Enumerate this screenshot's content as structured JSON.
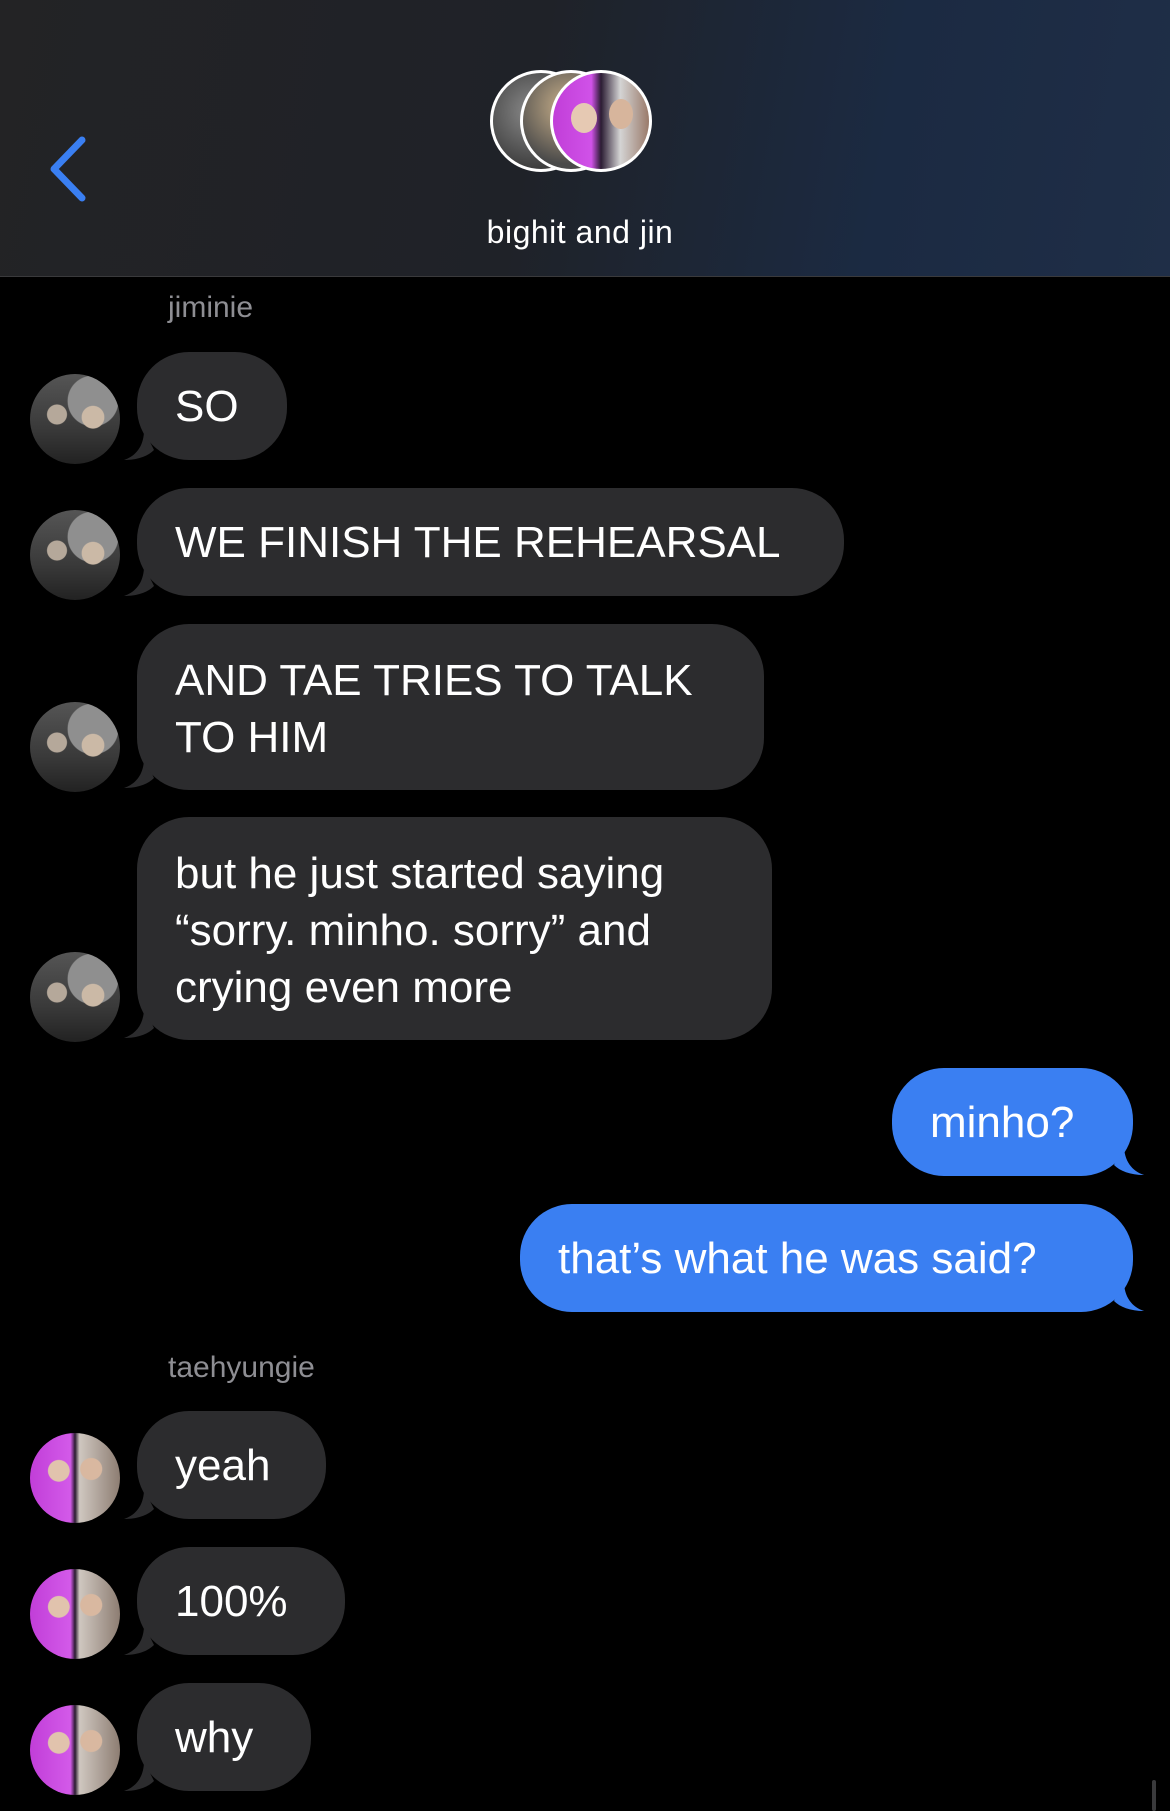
{
  "header": {
    "title": "bighit and jin",
    "back_icon": "chevron-left-icon",
    "accent": "#3a7ff2"
  },
  "senders": {
    "first": "jiminie",
    "second": "taehyungie"
  },
  "messages": [
    {
      "from": "jiminie",
      "text": "SO"
    },
    {
      "from": "jiminie",
      "text": "WE FINISH THE REHEARSAL"
    },
    {
      "from": "jiminie",
      "text": "AND TAE TRIES TO TALK TO HIM"
    },
    {
      "from": "jiminie",
      "text": "but he just started saying “sorry. minho. sorry” and crying even more"
    },
    {
      "from": "me",
      "text": "minho?"
    },
    {
      "from": "me",
      "text": "that’s what he was said?"
    },
    {
      "from": "taehyungie",
      "text": "yeah"
    },
    {
      "from": "taehyungie",
      "text": "100%"
    },
    {
      "from": "taehyungie",
      "text": "why"
    }
  ],
  "colors": {
    "incoming_bubble": "#2c2c2e",
    "outgoing_bubble": "#3a7ff2",
    "sender_label": "#8e8e93"
  }
}
